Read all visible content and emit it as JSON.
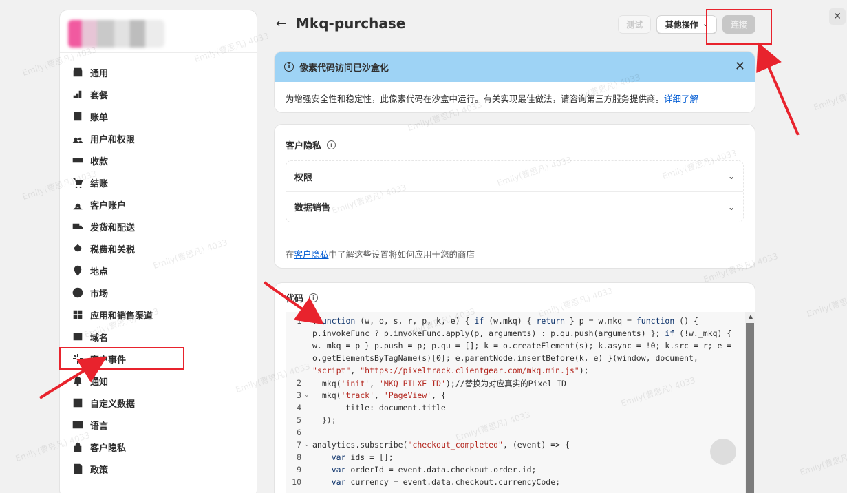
{
  "header": {
    "back": "←",
    "title": "Mkq-purchase",
    "btn_test": "测试",
    "btn_more": "其他操作",
    "btn_connect": "连接",
    "close": "✕"
  },
  "sidebar": {
    "items": [
      {
        "label": "通用",
        "icon": "store-icon"
      },
      {
        "label": "套餐",
        "icon": "plan-icon"
      },
      {
        "label": "账单",
        "icon": "billing-icon"
      },
      {
        "label": "用户和权限",
        "icon": "users-icon"
      },
      {
        "label": "收款",
        "icon": "payments-icon"
      },
      {
        "label": "结账",
        "icon": "cart-icon"
      },
      {
        "label": "客户账户",
        "icon": "person-icon"
      },
      {
        "label": "发货和配送",
        "icon": "truck-icon"
      },
      {
        "label": "税费和关税",
        "icon": "tax-icon"
      },
      {
        "label": "地点",
        "icon": "location-icon"
      },
      {
        "label": "市场",
        "icon": "globe-icon"
      },
      {
        "label": "应用和销售渠道",
        "icon": "apps-icon"
      },
      {
        "label": "域名",
        "icon": "domain-icon"
      },
      {
        "label": "客户事件",
        "icon": "events-icon"
      },
      {
        "label": "通知",
        "icon": "bell-icon"
      },
      {
        "label": "自定义数据",
        "icon": "data-icon"
      },
      {
        "label": "语言",
        "icon": "language-icon"
      },
      {
        "label": "客户隐私",
        "icon": "lock-icon"
      },
      {
        "label": "政策",
        "icon": "policy-icon"
      }
    ]
  },
  "banner": {
    "title": "像素代码访问已沙盒化",
    "body": "为增强安全性和稳定性，此像素代码在沙盒中运行。有关实现最佳做法，请咨询第三方服务提供商。",
    "link": "详细了解"
  },
  "privacy": {
    "title": "客户隐私",
    "rows": [
      "权限",
      "数据销售"
    ],
    "note_prefix": "在",
    "note_link": "客户隐私",
    "note_suffix": "中了解这些设置将如何应用于您的商店"
  },
  "code": {
    "title": "代码",
    "lines": [
      {
        "n": "1",
        "t": "!function (w, o, s, r, p, k, e) { if (w.mkq) { return } p = w.mkq = function () {"
      },
      {
        "n": "",
        "t": "p.invokeFunc ? p.invokeFunc.apply(p, arguments) : p.qu.push(arguments) }; if (!w._mkq) {"
      },
      {
        "n": "",
        "t": "w._mkq = p } p.push = p; p.qu = []; k = o.createElement(s); k.async = !0; k.src = r; e ="
      },
      {
        "n": "",
        "t": "o.getElementsByTagName(s)[0]; e.parentNode.insertBefore(k, e) }(window, document,"
      },
      {
        "n": "",
        "t": "\"script\", \"https://pixeltrack.clientgear.com/mkq.min.js\");"
      },
      {
        "n": "2",
        "t": "  mkq('init', 'MKQ_PILXE_ID');//替换为对应真实的Pixel ID"
      },
      {
        "n": "3",
        "t": "  mkq('track', 'PageView', {"
      },
      {
        "n": "4",
        "t": "       title: document.title"
      },
      {
        "n": "5",
        "t": "  });"
      },
      {
        "n": "6",
        "t": ""
      },
      {
        "n": "7",
        "t": "analytics.subscribe(\"checkout_completed\", (event) => {"
      },
      {
        "n": "8",
        "t": "    var ids = [];"
      },
      {
        "n": "9",
        "t": "    var orderId = event.data.checkout.order.id;"
      },
      {
        "n": "10",
        "t": "    var currency = event.data.checkout.currencyCode;"
      }
    ]
  },
  "watermark": "Emily(曹思凡) 4033",
  "colors": {
    "accent_red": "#e8232d",
    "banner_blue": "#9ed3f5",
    "link_blue": "#005bd3"
  }
}
